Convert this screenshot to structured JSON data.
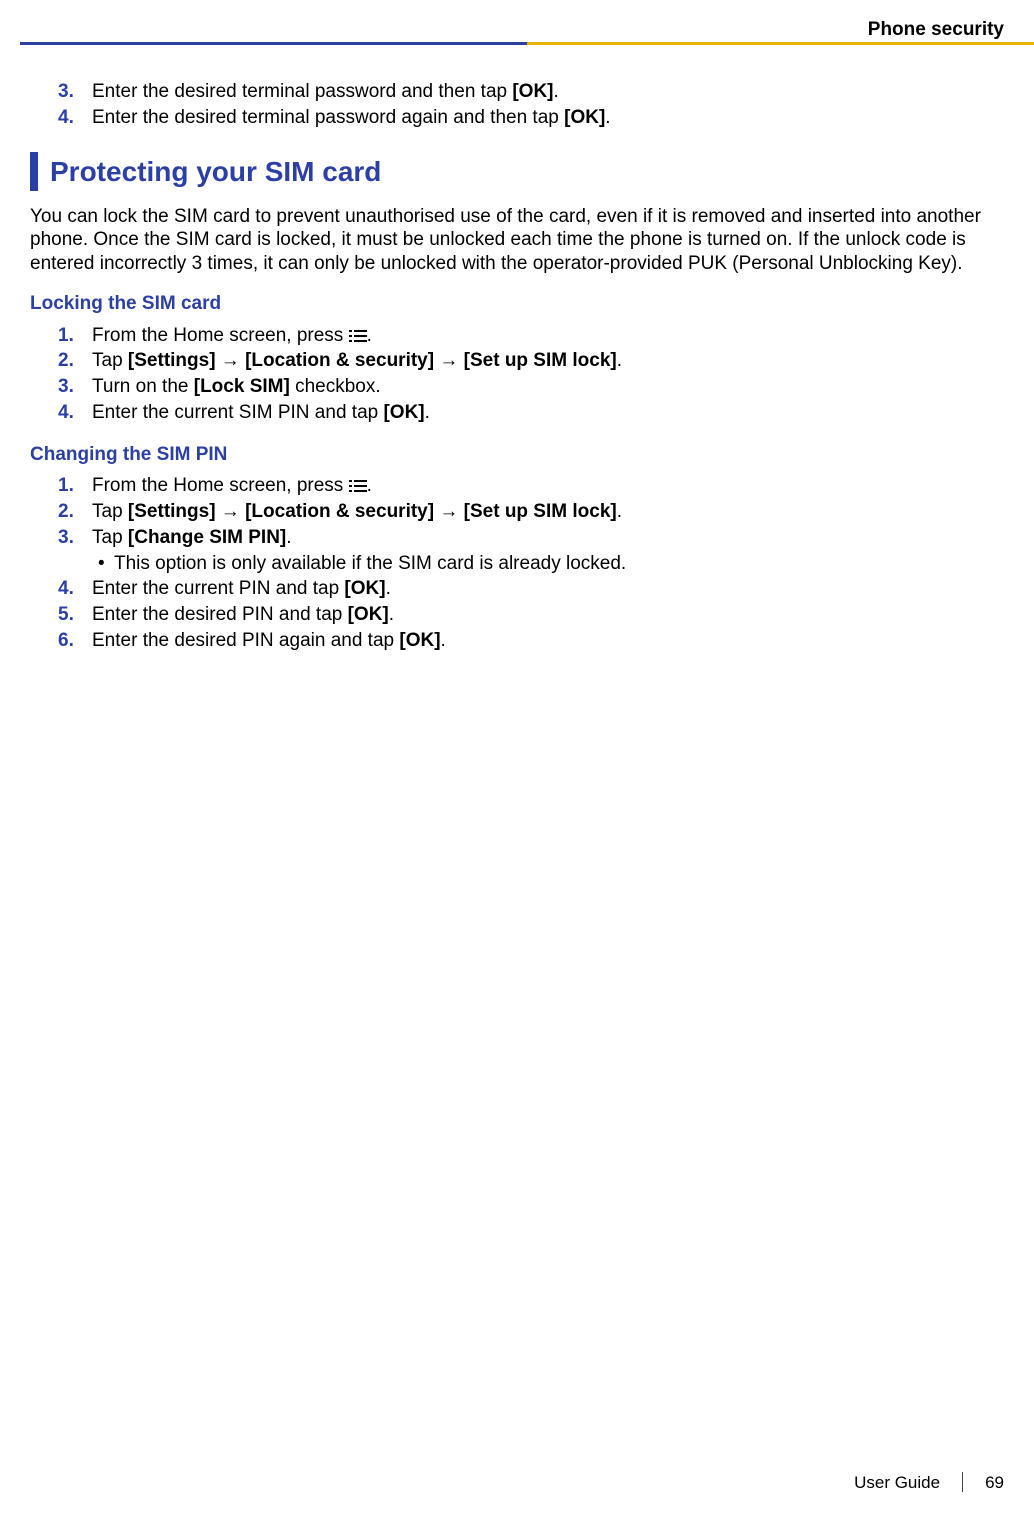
{
  "header": {
    "section": "Phone security"
  },
  "steps_top": [
    {
      "n": "3.",
      "pre": "Enter the desired terminal password and then tap ",
      "bold": "[OK]",
      "post": "."
    },
    {
      "n": "4.",
      "pre": "Enter the desired terminal password again and then tap ",
      "bold": "[OK]",
      "post": "."
    }
  ],
  "section": {
    "title": "Protecting your SIM card"
  },
  "intro": "You can lock the SIM card to prevent unauthorised use of the card, even if it is removed and inserted into another phone. Once the SIM card is locked, it must be unlocked each time the phone is turned on. If the unlock code is entered incorrectly 3 times, it can only be unlocked with the operator-provided PUK (Personal Unblocking Key).",
  "sub1": {
    "title": "Locking the SIM card"
  },
  "sub1_steps": {
    "s1_pre": "From the Home screen, press ",
    "s1_post": ".",
    "s2_pre": "Tap ",
    "s2_b1": "[Settings]",
    "s2_arr": " → ",
    "s2_b2": "[Location & security]",
    "s2_b3": "[Set up SIM lock]",
    "s2_post": ".",
    "s3_pre": "Turn on the ",
    "s3_b": "[Lock SIM]",
    "s3_post": " checkbox.",
    "s4_pre": "Enter the current SIM PIN and tap ",
    "s4_b": "[OK]",
    "s4_post": "."
  },
  "nums": {
    "n1": "1.",
    "n2": "2.",
    "n3": "3.",
    "n4": "4.",
    "n5": "5.",
    "n6": "6."
  },
  "sub2": {
    "title": "Changing the SIM PIN"
  },
  "sub2_steps": {
    "s1_pre": "From the Home screen, press ",
    "s1_post": ".",
    "s2_pre": "Tap ",
    "s2_b1": "[Settings]",
    "s2_arr": " → ",
    "s2_b2": "[Location & security]",
    "s2_b3": "[Set up SIM lock]",
    "s2_post": ".",
    "s3_pre": "Tap ",
    "s3_b": "[Change SIM PIN]",
    "s3_post": ".",
    "s3_bullet": "This option is only available if the SIM card is already locked.",
    "s4_pre": "Enter the current PIN and tap ",
    "s4_b": "[OK]",
    "s4_post": ".",
    "s5_pre": "Enter the desired PIN and tap ",
    "s5_b": "[OK]",
    "s5_post": ".",
    "s6_pre": "Enter the desired PIN again and tap ",
    "s6_b": "[OK]",
    "s6_post": "."
  },
  "footer": {
    "label": "User Guide",
    "page": "69"
  }
}
